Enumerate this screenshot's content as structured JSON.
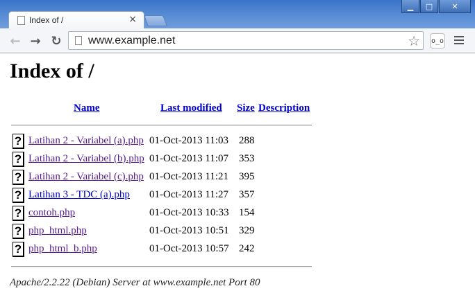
{
  "window": {
    "minimize_glyph": "▁",
    "maximize_glyph": "□",
    "close_glyph": "✕"
  },
  "tab": {
    "title": "Index of /",
    "close_glyph": "×"
  },
  "toolbar": {
    "back_glyph": "←",
    "forward_glyph": "→",
    "reload_glyph": "↻",
    "url": "www.example.net",
    "star_glyph": "☆",
    "extension_label": "o_o"
  },
  "page": {
    "heading": "Index of /",
    "columns": {
      "name": "Name",
      "last_modified": "Last modified",
      "size": "Size",
      "description": "Description"
    },
    "files": [
      {
        "name": "Latihan 2 - Variabel (a).php",
        "modified": "01-Oct-2013 11:03",
        "size": "288",
        "visited": true
      },
      {
        "name": "Latihan 2 - Variabel (b).php",
        "modified": "01-Oct-2013 11:07",
        "size": "353",
        "visited": true
      },
      {
        "name": "Latihan 2 - Variabel (c).php",
        "modified": "01-Oct-2013 11:21",
        "size": "395",
        "visited": true
      },
      {
        "name": "Latihan 3 - TDC (a).php",
        "modified": "01-Oct-2013 11:27",
        "size": "357",
        "visited": false
      },
      {
        "name": "contoh.php",
        "modified": "01-Oct-2013 10:33",
        "size": "154",
        "visited": true
      },
      {
        "name": "php_html.php",
        "modified": "01-Oct-2013 10:51",
        "size": "329",
        "visited": true
      },
      {
        "name": "php_html_b.php",
        "modified": "01-Oct-2013 10:57",
        "size": "242",
        "visited": true
      }
    ],
    "file_icon_glyph": "?",
    "footer": "Apache/2.2.22 (Debian) Server at www.example.net Port 80"
  }
}
